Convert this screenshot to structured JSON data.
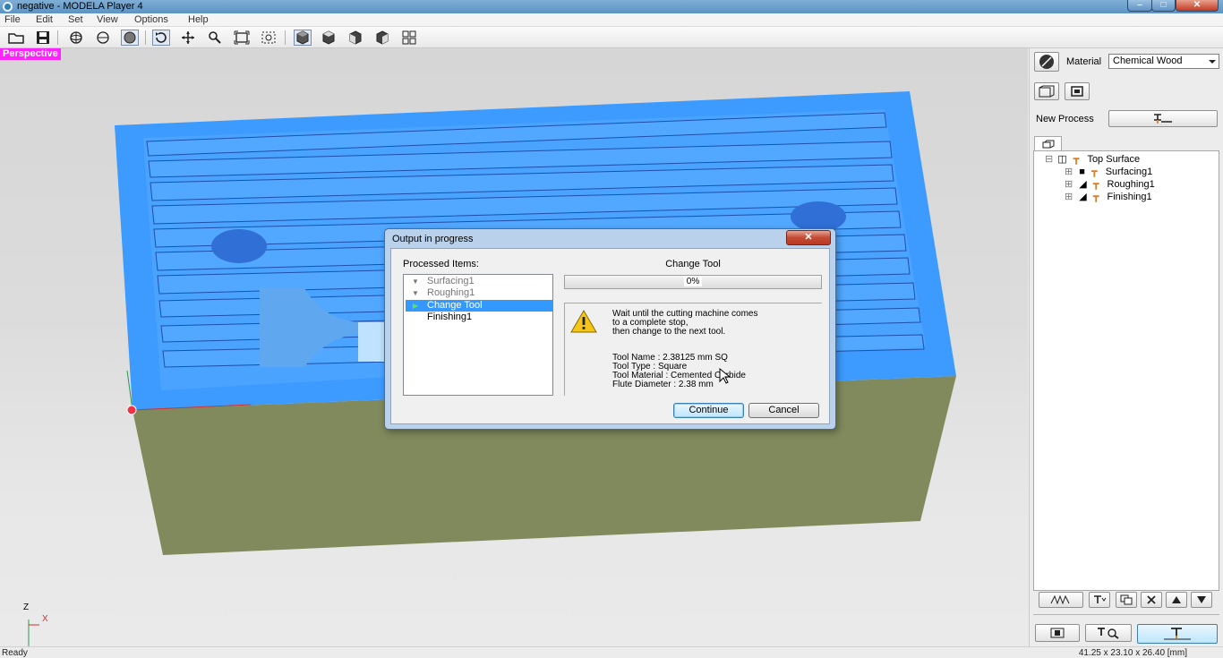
{
  "window": {
    "title": "negative - MODELA Player 4",
    "min": "–",
    "max": "□",
    "close": "✕"
  },
  "menu": [
    "File",
    "Edit",
    "Set",
    "View",
    "Options",
    "Help"
  ],
  "toolbar_icons": [
    "open-folder-icon",
    "save-icon",
    "orbit-icon",
    "globe-icon",
    "sphere-icon",
    "rotate-icon",
    "pan-icon",
    "zoom-icon",
    "fit-icon",
    "zoom-box-icon",
    "view-iso-icon",
    "view-top-icon",
    "view-front-icon",
    "view-side-icon",
    "view-multi-icon"
  ],
  "viewport": {
    "label": "Perspective",
    "axis_z": "Z",
    "axis_x": "X"
  },
  "panel": {
    "material_label": "Material",
    "material_value": "Chemical Wood",
    "new_process_label": "New Process",
    "tree": [
      {
        "toggle": "⊟",
        "mark": "",
        "label": "Top Surface"
      },
      {
        "toggle": "⊞",
        "mark": "■",
        "label": "Surfacing1"
      },
      {
        "toggle": "⊞",
        "mark": "◢",
        "label": "Roughing1"
      },
      {
        "toggle": "⊞",
        "mark": "◢",
        "label": "Finishing1"
      }
    ]
  },
  "dialog": {
    "title": "Output in progress",
    "close": "✕",
    "processed_label": "Processed Items:",
    "items": [
      {
        "marker": "▼",
        "label": "Surfacing1",
        "state": "done"
      },
      {
        "marker": "▼",
        "label": "Roughing1",
        "state": "done"
      },
      {
        "marker": "▶",
        "label": "Change Tool",
        "state": "current"
      },
      {
        "marker": "",
        "label": "Finishing1",
        "state": "pending"
      }
    ],
    "heading": "Change Tool",
    "progress_text": "0%",
    "progress": 0,
    "message": [
      "Wait until the cutting machine comes",
      "to a complete stop,",
      "then change to the next tool."
    ],
    "details": [
      "Tool Name : 2.38125 mm SQ",
      "Tool Type : Square",
      "Tool Material : Cemented Carbide",
      "Flute Diameter : 2.38 mm"
    ],
    "continue": "Continue",
    "cancel": "Cancel"
  },
  "status": {
    "left": "Ready",
    "right": "41.25 x 23.10 x 26.40 [mm]"
  },
  "colors": {
    "model_blue": "#3d9bff",
    "model_side": "#808a5c",
    "selection": "#3399ff",
    "badge": "#ff22ff"
  }
}
